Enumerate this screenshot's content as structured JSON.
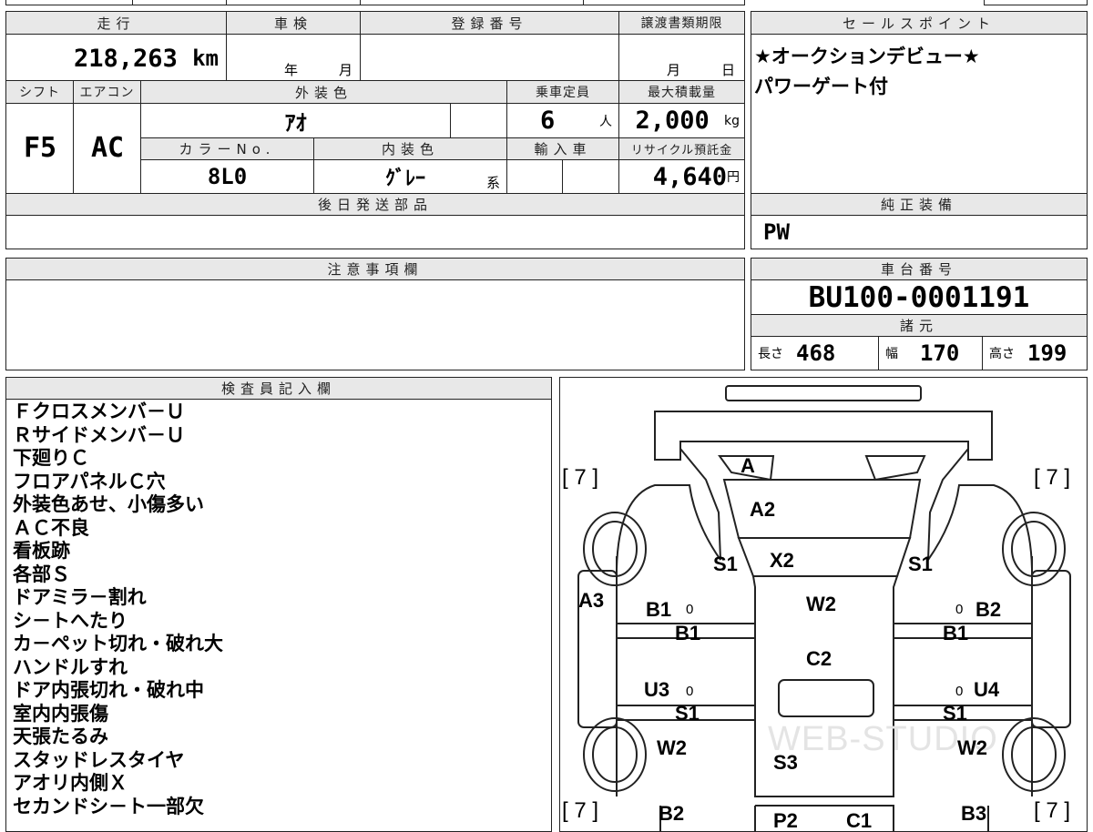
{
  "mileage": {
    "header": "走行",
    "value": "218,263",
    "unit": "km"
  },
  "shaken": {
    "header": "車検",
    "year_unit": "年",
    "month_unit": "月"
  },
  "registration": {
    "header": "登録番号",
    "value": ""
  },
  "transfer_deadline": {
    "header": "譲渡書類期限",
    "month_unit": "月",
    "day_unit": "日"
  },
  "shift": {
    "header": "シフト",
    "value": "F5"
  },
  "aircon": {
    "header": "エアコン",
    "value": "AC"
  },
  "exterior_color": {
    "header": "外装色",
    "value": "ｱｵ"
  },
  "capacity": {
    "header": "乗車定員",
    "value": "6",
    "unit": "人"
  },
  "max_load": {
    "header": "最大積載量",
    "value": "2,000",
    "unit": "kg"
  },
  "color_no": {
    "header": "カラーNo.",
    "value": "8L0"
  },
  "interior_color": {
    "header": "内装色",
    "value": "ｸﾞﾚｰ",
    "suffix": "系"
  },
  "import_car": {
    "header": "輸入車"
  },
  "recycle": {
    "header": "リサイクル預託金",
    "value": "4,640",
    "unit": "円"
  },
  "later_parts": {
    "header": "後日発送部品"
  },
  "sales_points": {
    "header": "セールスポイント",
    "lines": [
      "★オークションデビュー★",
      "パワーゲート付"
    ]
  },
  "genuine_equipment": {
    "header": "純正装備",
    "value": "PW"
  },
  "notes": {
    "header": "注意事項欄"
  },
  "chassis": {
    "header": "車台番号",
    "value": "BU100-0001191"
  },
  "specs": {
    "header": "諸元",
    "length_label": "長さ",
    "length": "468",
    "width_label": "幅",
    "width": "170",
    "height_label": "高さ",
    "height": "199"
  },
  "inspector": {
    "header": "検査員記入欄",
    "lines": [
      "Ｆクロスメンバ－Ｕ",
      "Ｒサイドメンバ－Ｕ",
      "下廻りＣ",
      "フロアパネルＣ穴",
      "外装色あせ、小傷多い",
      "ＡＣ不良",
      "看板跡",
      "各部Ｓ",
      "ドアミラ－割れ",
      "シ－トへたり",
      "カ－ペット切れ・破れ大",
      "ハンドルすれ",
      "ドア内張切れ・破れ中",
      "室内内張傷",
      "天張たるみ",
      "スタッドレスタイヤ",
      "アオリ内側Ｘ",
      "セカンドシ－ト一部欠"
    ]
  },
  "diagram": {
    "tire_labels": [
      "[ 7 ]",
      "[ 7 ]",
      "[ 7 ]",
      "[ 7 ]"
    ],
    "zero": "0",
    "watermark": "WEB-STUDIO",
    "marks": {
      "a": "A",
      "a2": "A2",
      "x2": "X2",
      "s1_fl": "S1",
      "s1_fr": "S1",
      "a3": "A3",
      "b1_l": "B1",
      "b1_l2": "B1",
      "w2_c": "W2",
      "b2_r": "B2",
      "b1_r": "B1",
      "c2": "C2",
      "u3": "U3",
      "u4": "U4",
      "s1_ll": "S1",
      "s1_lr": "S1",
      "w2_l": "W2",
      "w2_r": "W2",
      "s3": "S3",
      "b2_l": "B2",
      "b3_r": "B3",
      "p2": "P2",
      "c1": "C1"
    }
  }
}
